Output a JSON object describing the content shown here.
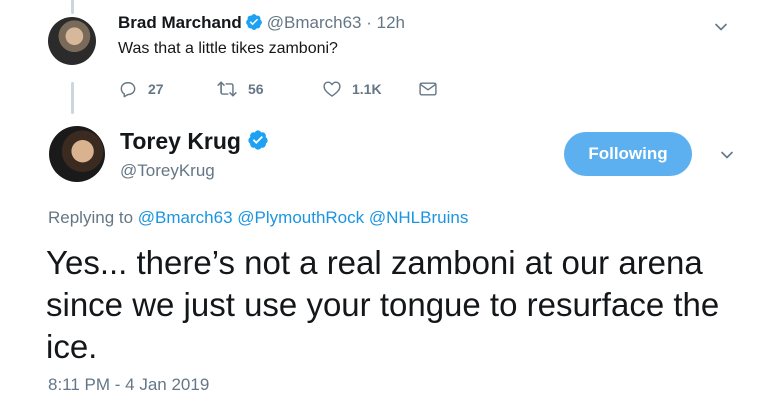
{
  "parent_tweet": {
    "name": "Brad Marchand",
    "handle": "@Bmarch63",
    "time": "· 12h",
    "text": "Was that a little tikes zamboni?",
    "reply_count": "27",
    "retweet_count": "56",
    "like_count": "1.1K"
  },
  "main_tweet": {
    "name": "Torey Krug",
    "handle": "@ToreyKrug",
    "follow_label": "Following",
    "replying_prefix": "Replying to",
    "mentions": [
      "@Bmarch63",
      "@PlymouthRock",
      "@NHLBruins"
    ],
    "text": "Yes... there’s not a real zamboni at our arena since we just use your tongue to resurface the ice.",
    "timestamp": "8:11 PM - 4 Jan 2019"
  },
  "colors": {
    "accent": "#1b95e0",
    "follow_button": "#5cb0ef",
    "muted": "#657786",
    "text": "#14171a"
  }
}
